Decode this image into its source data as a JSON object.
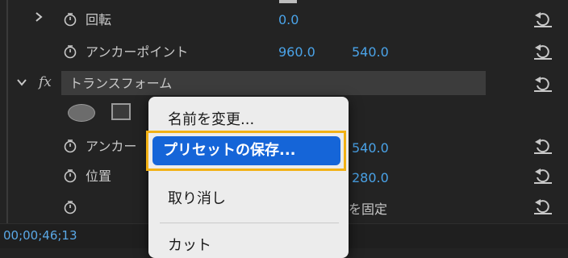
{
  "properties": {
    "rotation": {
      "label": "回転",
      "value": "0.0"
    },
    "anchor": {
      "label": "アンカーポイント",
      "x": "960.0",
      "y": "540.0"
    },
    "transform_group": {
      "label": "トランスフォーム",
      "fx": "fx"
    },
    "anchor2": {
      "label": "アンカー",
      "y": "540.0"
    },
    "position": {
      "label": "位置",
      "y": "280.0"
    },
    "fixed": {
      "label": "を固定"
    }
  },
  "status": {
    "timecode": "00;00;46;13"
  },
  "context_menu": {
    "items": [
      {
        "label": "名前を変更..."
      },
      {
        "label": "プリセットの保存..."
      },
      {
        "label": "取り消し"
      },
      {
        "label": "カット"
      }
    ],
    "highlight_color": "#1565d8",
    "outline_color": "#f2b115"
  },
  "colors": {
    "value": "#4aa3e8",
    "background": "#232323"
  }
}
